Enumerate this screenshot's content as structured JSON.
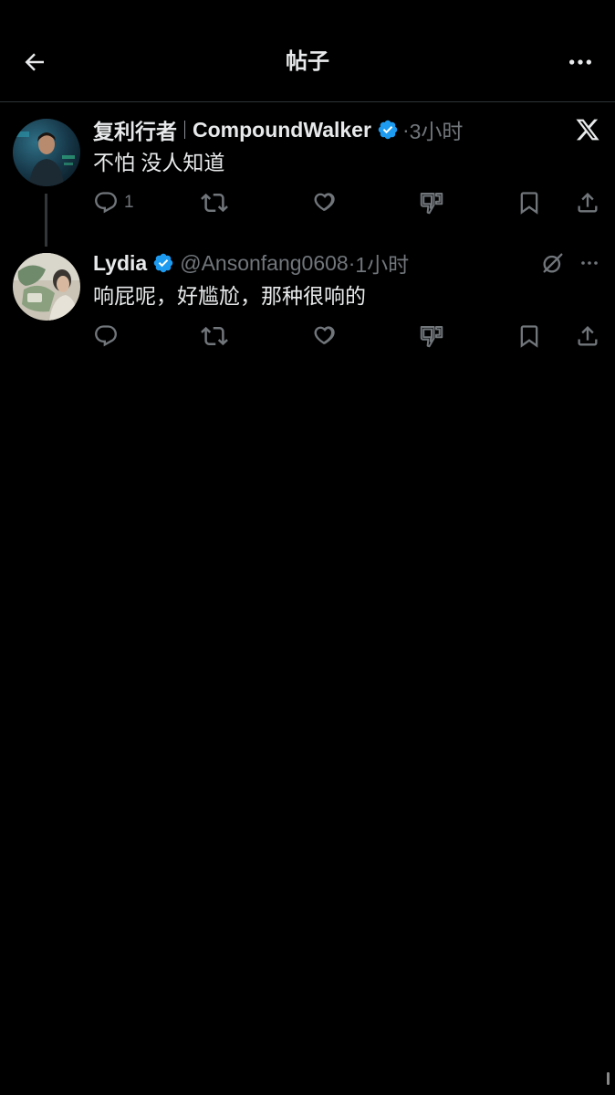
{
  "header": {
    "title": "帖子",
    "back_icon": "arrow-left-icon",
    "more_icon": "more-horizontal-icon"
  },
  "posts": [
    {
      "display_name": "复利行者",
      "handle": "CompoundWalker",
      "verified": true,
      "time": "3小时",
      "text": "不怕 没人知道",
      "reply_count": "1",
      "corner_icon": "x-logo-icon"
    },
    {
      "display_name": "Lydia",
      "handle": "@Ansonfang0608",
      "verified": true,
      "time": "1小时",
      "text": "响屁呢，好尴尬，那种很响的",
      "reply_count": "",
      "corner_icon": "grok-icon"
    }
  ],
  "colors": {
    "background": "#000000",
    "text": "#e7e9ea",
    "secondary": "#71767b",
    "verified": "#1d9bf0",
    "border": "#2f3336"
  }
}
